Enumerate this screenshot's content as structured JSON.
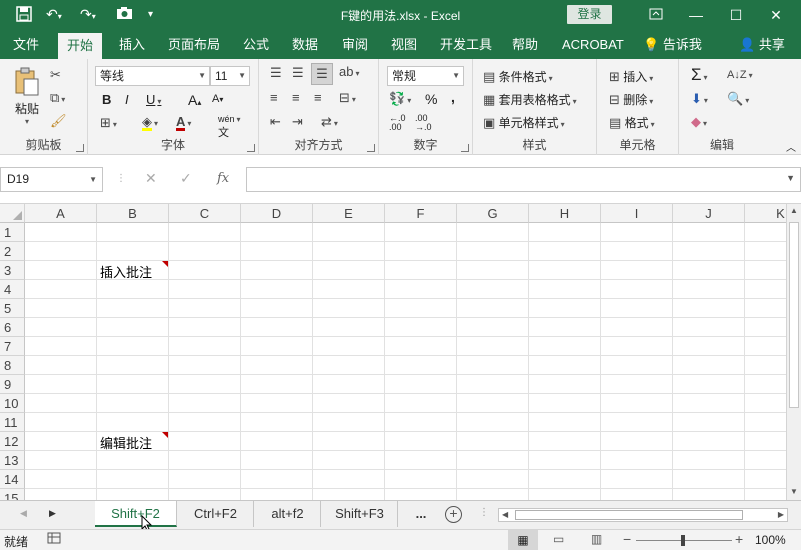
{
  "titlebar": {
    "title": "F键的用法.xlsx  -  Excel",
    "login_label": "登录",
    "icons": [
      "save-icon",
      "undo-icon",
      "redo-icon",
      "camera-icon",
      "customize-qat-icon"
    ]
  },
  "ribbon_tabs": [
    "文件",
    "开始",
    "插入",
    "页面布局",
    "公式",
    "数据",
    "审阅",
    "视图",
    "开发工具",
    "帮助",
    "ACROBAT",
    "告诉我",
    "共享"
  ],
  "active_tab": "开始",
  "clipboard": {
    "paste_label": "粘贴",
    "group_label": "剪贴板"
  },
  "font": {
    "name": "等线",
    "size": "11",
    "group_label": "字体",
    "phonetic_label": "wén"
  },
  "alignment": {
    "group_label": "对齐方式"
  },
  "number": {
    "format": "常规",
    "percent": "%",
    "comma": ",",
    "inc_decimal": ".0→.00",
    "dec_decimal": ".00→.0",
    "group_label": "数字"
  },
  "styles": {
    "conditional": "条件格式",
    "table": "套用表格格式",
    "cell_styles": "单元格样式",
    "group_label": "样式"
  },
  "cells": {
    "insert": "插入",
    "delete": "删除",
    "format": "格式",
    "group_label": "单元格"
  },
  "editing": {
    "group_label": "编辑"
  },
  "formulabar": {
    "namebox": "D19",
    "fx": "fx",
    "formula": ""
  },
  "columns": [
    "A",
    "B",
    "C",
    "D",
    "E",
    "F",
    "G",
    "H",
    "I",
    "J",
    "K"
  ],
  "rows": [
    "1",
    "2",
    "3",
    "4",
    "5",
    "6",
    "7",
    "8",
    "9",
    "10",
    "11",
    "12",
    "13",
    "14",
    "15"
  ],
  "cell_content": {
    "B3": "插入批注",
    "B12": "编辑批注"
  },
  "sheets": [
    "Shift+F2",
    "Ctrl+F2",
    "alt+f2",
    "Shift+F3",
    "..."
  ],
  "active_sheet": "Shift+F2",
  "status": {
    "ready": "就绪",
    "zoom": "100%",
    "zoom_minus": "−",
    "zoom_plus": "+"
  },
  "colors": {
    "accent": "#217346",
    "comment_marker": "#c00000"
  }
}
